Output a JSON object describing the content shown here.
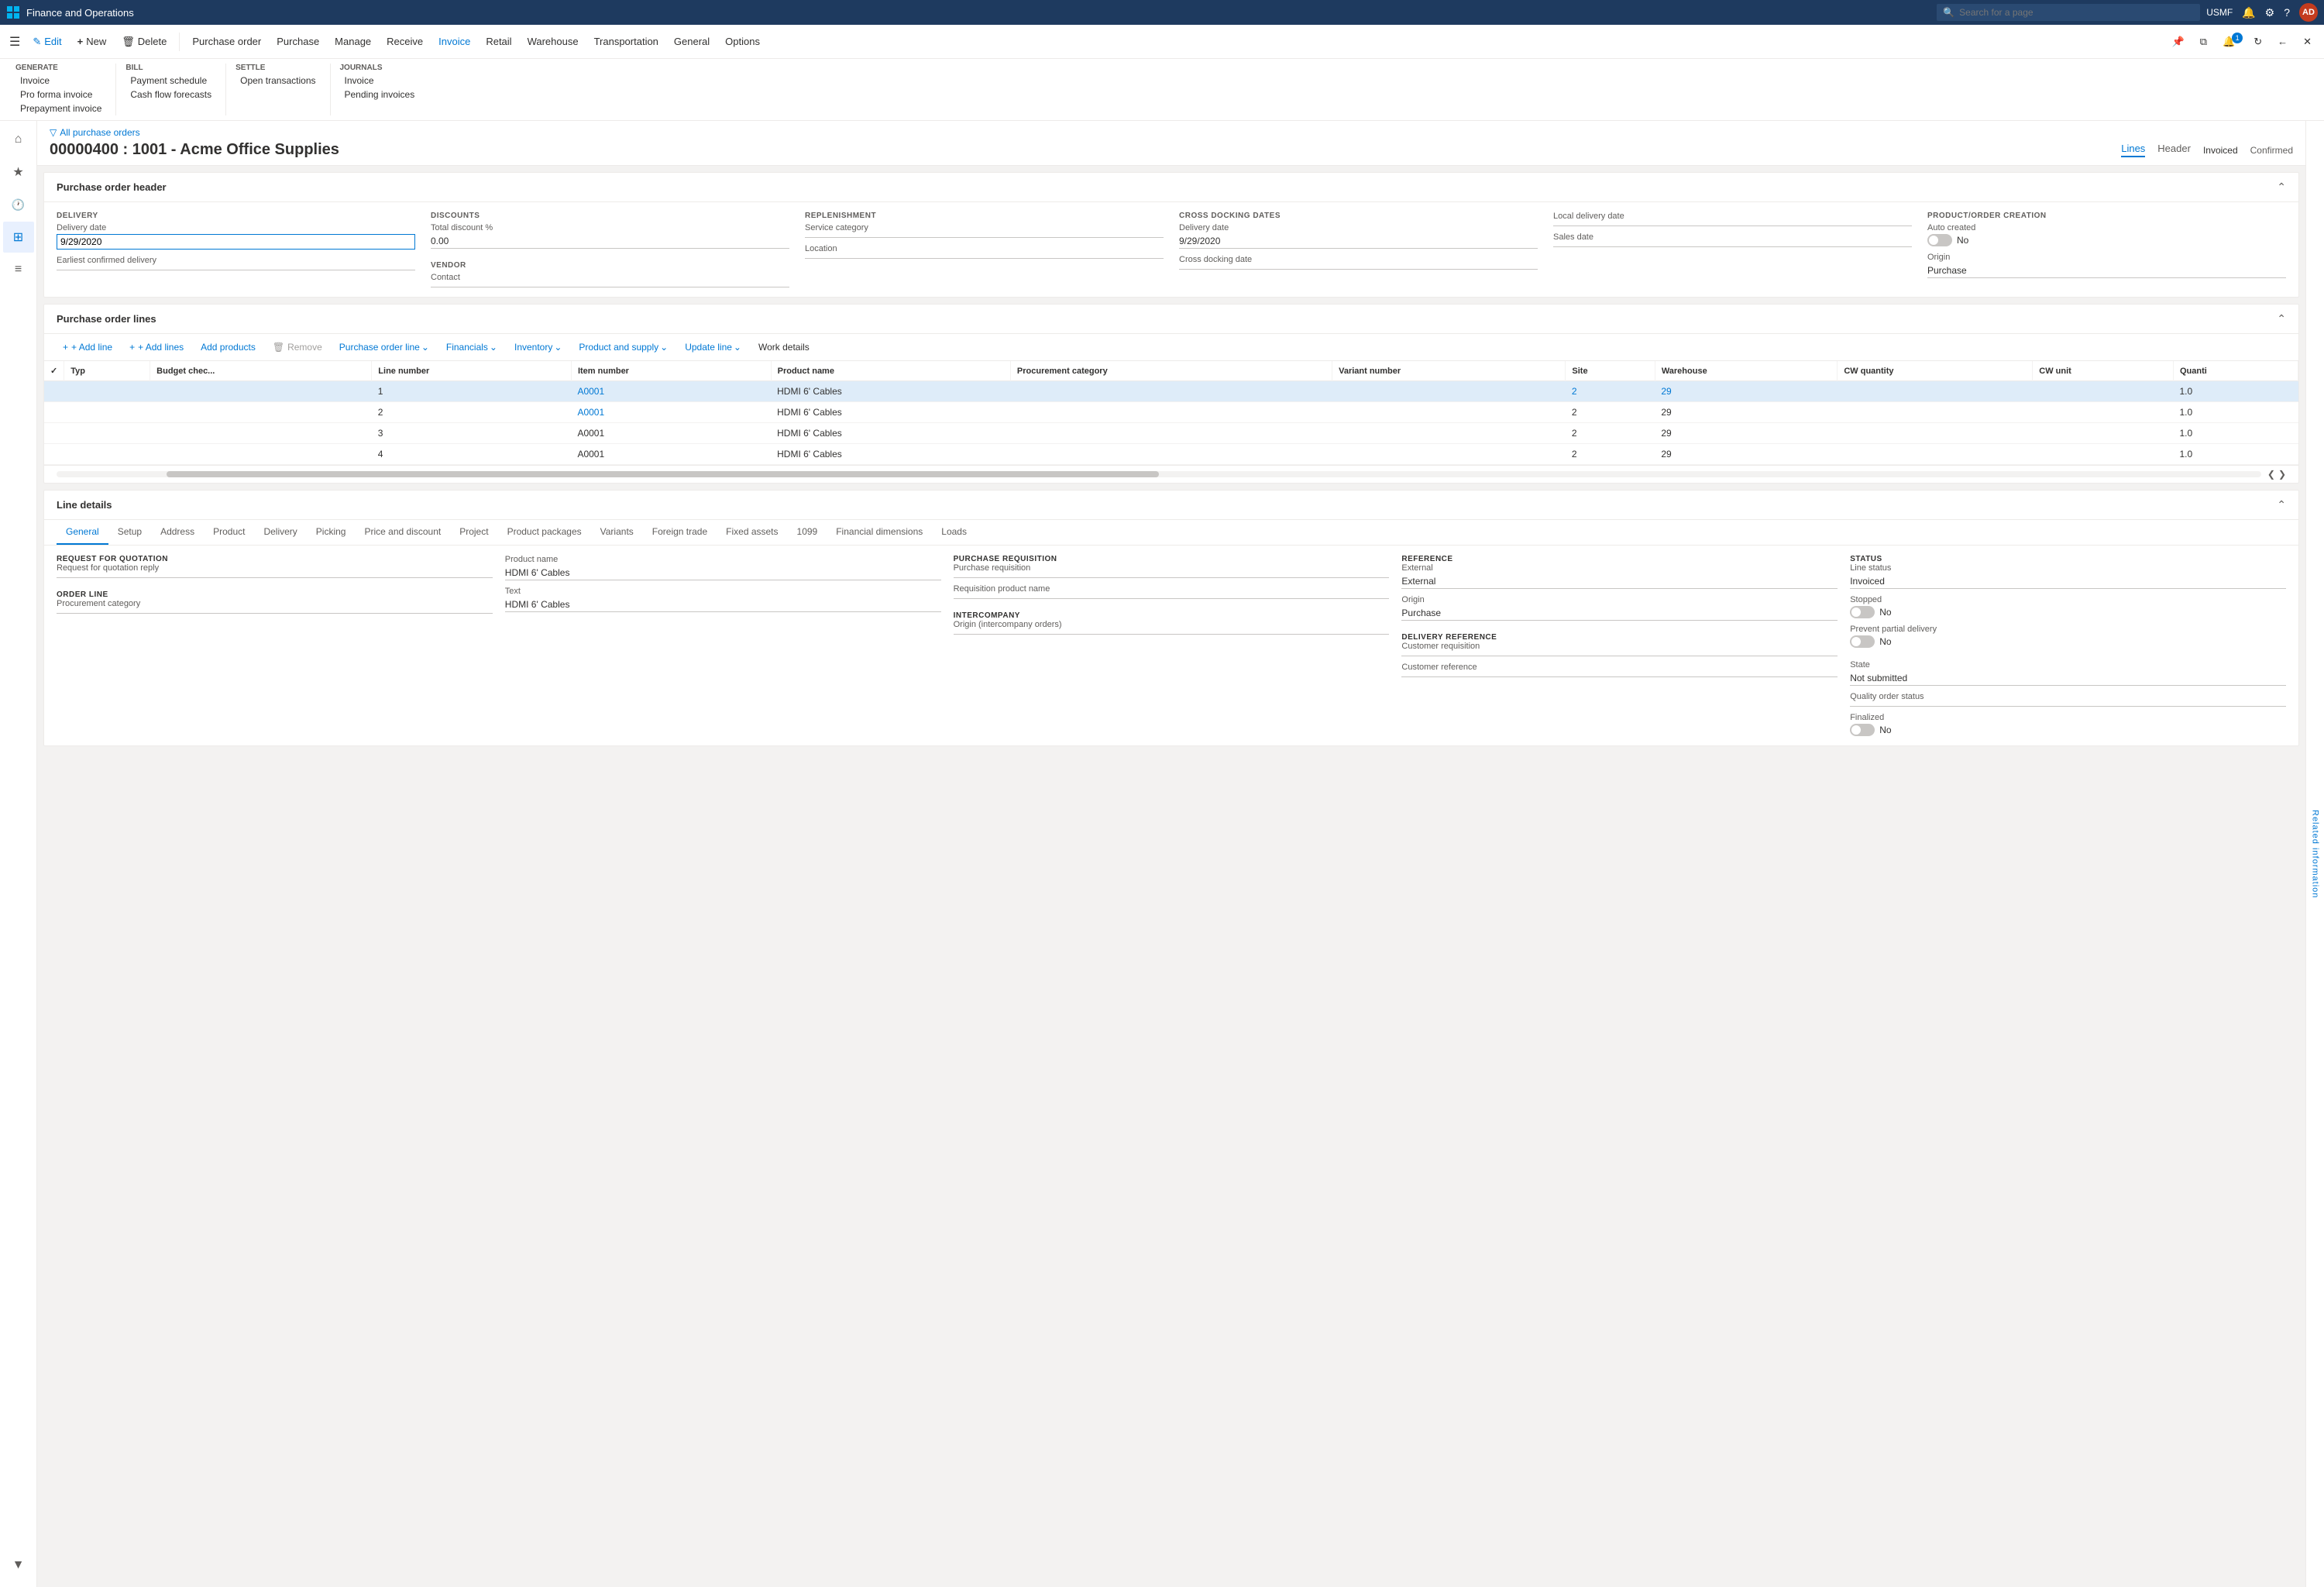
{
  "titleBar": {
    "appName": "Finance and Operations",
    "searchPlaceholder": "Search for a page",
    "userCode": "USMF",
    "avatarInitials": "AD"
  },
  "commandBar": {
    "editLabel": "Edit",
    "newLabel": "New",
    "deleteLabel": "Delete",
    "purchaseOrderLabel": "Purchase order",
    "purchaseLabel": "Purchase",
    "manageLabel": "Manage",
    "receiveLabel": "Receive",
    "invoiceLabel": "Invoice",
    "retailLabel": "Retail",
    "warehouseLabel": "Warehouse",
    "transportationLabel": "Transportation",
    "generalLabel": "General",
    "optionsLabel": "Options"
  },
  "ribbon": {
    "groups": [
      {
        "title": "Generate",
        "items": [
          "Invoice",
          "Pro forma invoice",
          "Prepayment invoice"
        ]
      },
      {
        "title": "Bill",
        "items": [
          "Payment schedule",
          "Cash flow forecasts"
        ]
      },
      {
        "title": "Settle",
        "items": [
          "Open transactions"
        ]
      },
      {
        "title": "Journals",
        "items": [
          "Invoice",
          "Pending invoices"
        ]
      }
    ]
  },
  "breadcrumb": "All purchase orders",
  "pageTitle": "00000400 : 1001 - Acme Office Supplies",
  "pageTabs": {
    "lines": "Lines",
    "header": "Header"
  },
  "pageStatus": {
    "invoiced": "Invoiced",
    "confirmed": "Confirmed"
  },
  "purchaseOrderHeader": {
    "sectionTitle": "Purchase order header",
    "delivery": {
      "label": "DELIVERY",
      "deliveryDateLabel": "Delivery date",
      "deliveryDateValue": "9/29/2020",
      "earliestConfirmedLabel": "Earliest confirmed delivery"
    },
    "discounts": {
      "label": "DISCOUNTS",
      "totalDiscountLabel": "Total discount %",
      "totalDiscountValue": "0.00"
    },
    "replenishment": {
      "label": "REPLENISHMENT",
      "serviceCategoryLabel": "Service category",
      "locationLabel": "Location"
    },
    "crossDocking": {
      "label": "CROSS DOCKING DATES",
      "deliveryDateLabel": "Delivery date",
      "deliveryDateValue": "9/29/2020",
      "crossDockingDateLabel": "Cross docking date"
    },
    "localDelivery": {
      "localDeliveryDateLabel": "Local delivery date",
      "salesDateLabel": "Sales date"
    },
    "productOrderCreation": {
      "label": "PRODUCT/ORDER CREATION",
      "autoCreatedLabel": "Auto created",
      "autoCreatedValue": "No",
      "originLabel": "Origin",
      "originValue": "Purchase"
    },
    "vendor": {
      "label": "VENDOR",
      "contactLabel": "Contact"
    }
  },
  "purchaseOrderLines": {
    "sectionTitle": "Purchase order lines",
    "toolbar": {
      "addLine": "+ Add line",
      "addLines": "+ Add lines",
      "addProducts": "Add products",
      "remove": "Remove",
      "purchaseOrderLine": "Purchase order line",
      "financials": "Financials",
      "inventory": "Inventory",
      "productAndSupply": "Product and supply",
      "updateLine": "Update line",
      "workDetails": "Work details"
    },
    "columns": [
      "",
      "Typ",
      "Budget chec...",
      "Line number",
      "Item number",
      "Product name",
      "Procurement category",
      "Variant number",
      "Site",
      "Warehouse",
      "CW quantity",
      "CW unit",
      "Quanti"
    ],
    "rows": [
      {
        "lineNumber": "1",
        "itemNumber": "A0001",
        "productName": "HDMI 6' Cables",
        "procurementCategory": "",
        "variantNumber": "",
        "site": "2",
        "warehouse": "29",
        "cwQuantity": "",
        "cwUnit": "",
        "quantity": "1.0"
      },
      {
        "lineNumber": "2",
        "itemNumber": "A0001",
        "productName": "HDMI 6' Cables",
        "procurementCategory": "",
        "variantNumber": "",
        "site": "2",
        "warehouse": "29",
        "cwQuantity": "",
        "cwUnit": "",
        "quantity": "1.0"
      },
      {
        "lineNumber": "3",
        "itemNumber": "A0001",
        "productName": "HDMI 6' Cables",
        "procurementCategory": "",
        "variantNumber": "",
        "site": "2",
        "warehouse": "29",
        "cwQuantity": "",
        "cwUnit": "",
        "quantity": "1.0"
      },
      {
        "lineNumber": "4",
        "itemNumber": "A0001",
        "productName": "HDMI 6' Cables",
        "procurementCategory": "",
        "variantNumber": "",
        "site": "2",
        "warehouse": "29",
        "cwQuantity": "",
        "cwUnit": "",
        "quantity": "1.0"
      }
    ]
  },
  "lineDetails": {
    "sectionTitle": "Line details",
    "tabs": [
      "General",
      "Setup",
      "Address",
      "Product",
      "Delivery",
      "Picking",
      "Price and discount",
      "Project",
      "Product packages",
      "Variants",
      "Foreign trade",
      "Fixed assets",
      "1099",
      "Financial dimensions",
      "Loads"
    ],
    "activeTab": "General",
    "sections": {
      "requestForQuotation": {
        "title": "REQUEST FOR QUOTATION",
        "requestLabel": "Request for quotation reply"
      },
      "orderLine": {
        "title": "ORDER LINE",
        "procurementCategoryLabel": "Procurement category"
      },
      "productName": {
        "label": "Product name",
        "value": "HDMI 6' Cables"
      },
      "text": {
        "label": "Text",
        "value": "HDMI 6' Cables"
      },
      "purchaseRequisition": {
        "title": "PURCHASE REQUISITION",
        "purchaseRequisitionLabel": "Purchase requisition",
        "requisitionProductNameLabel": "Requisition product name"
      },
      "intercompany": {
        "title": "INTERCOMPANY",
        "originLabel": "Origin (intercompany orders)"
      },
      "reference": {
        "title": "REFERENCE",
        "externalLabel": "External",
        "externalValue": "External",
        "originLabel": "Origin",
        "originValue": "Purchase"
      },
      "deliveryReference": {
        "title": "DELIVERY REFERENCE",
        "customerRequisitionLabel": "Customer requisition",
        "customerReferenceLabel": "Customer reference"
      },
      "status": {
        "title": "STATUS",
        "lineStatusLabel": "Line status",
        "lineStatusValue": "Invoiced",
        "stoppedLabel": "Stopped",
        "stoppedValue": "No",
        "preventPartialLabel": "Prevent partial delivery",
        "preventPartialValue": "No"
      },
      "state": {
        "stateLabel": "State",
        "stateValue": "Not submitted",
        "qualityOrderStatusLabel": "Quality order status",
        "finalizedLabel": "Finalized",
        "finalizedValue": "No"
      }
    }
  },
  "rightPanel": {
    "label": "Related information"
  },
  "icons": {
    "hamburger": "☰",
    "home": "⌂",
    "star": "★",
    "clock": "🕐",
    "grid": "⊞",
    "list": "≡",
    "filter": "▼",
    "pencil": "✎",
    "plus": "+",
    "trash": "🗑",
    "search": "🔍",
    "chevronDown": "⌄",
    "chevronUp": "⌃",
    "chevronLeft": "❮",
    "chevronRight": "❯",
    "collapse": "⌃",
    "expand": "⌄",
    "pinned": "📌",
    "copy": "⧉",
    "bell": "🔔",
    "gear": "⚙",
    "question": "?",
    "close": "✕",
    "check": "✓",
    "back": "←",
    "forward": "→"
  }
}
